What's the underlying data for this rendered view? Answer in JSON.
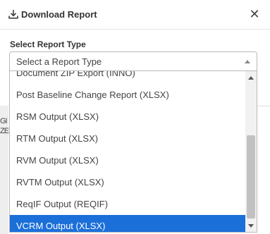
{
  "modal": {
    "title": "Download Report",
    "close_icon": "close-icon",
    "title_icon": "download-icon"
  },
  "field": {
    "label": "Select Report Type",
    "placeholder": "Select a Report Type"
  },
  "dropdown": {
    "options": [
      "Document ZIP Export (INNO)",
      "Post Baseline Change Report (XLSX)",
      "RSM Output (XLSX)",
      "RTM Output (XLSX)",
      "RVM Output (XLSX)",
      "RVTM Output (XLSX)",
      "ReqIF Output (REQIF)",
      "VCRM Output (XLSX)"
    ],
    "highlighted": "VCRM Output (XLSX)",
    "highlight_color": "#1b6fd9"
  },
  "backdrop": {
    "fragments": [
      "GI",
      "ZE"
    ]
  }
}
